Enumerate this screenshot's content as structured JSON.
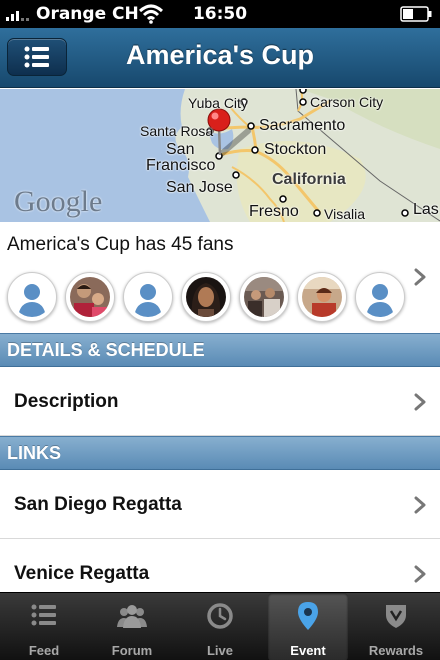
{
  "status_bar": {
    "carrier": "Orange CH",
    "time": "16:50"
  },
  "nav": {
    "title": "America's Cup",
    "menu_icon": "list-icon"
  },
  "map": {
    "attribution": "Google",
    "places": {
      "yuba_city": "Yuba City",
      "carson_city": "Carson City",
      "santa_rosa": "Santa Rosa",
      "sacramento": "Sacramento",
      "san_francisco_1": "San",
      "san_francisco_2": "Francisco",
      "stockton": "Stockton",
      "california": "California",
      "san_jose": "San Jose",
      "fresno": "Fresno",
      "visalia": "Visalia",
      "las": "Las"
    }
  },
  "fans": {
    "title": "America's Cup has 45 fans",
    "avatars": [
      "placeholder",
      "photo",
      "placeholder",
      "photo",
      "photo",
      "photo",
      "placeholder"
    ]
  },
  "sections": {
    "details_header": "DETAILS & SCHEDULE",
    "description": "Description",
    "links_header": "LINKS",
    "san_diego": "San Diego Regatta",
    "venice": "Venice Regatta"
  },
  "tabs": [
    {
      "label": "Feed",
      "icon": "list-icon"
    },
    {
      "label": "Forum",
      "icon": "people-icon"
    },
    {
      "label": "Live",
      "icon": "clock-icon"
    },
    {
      "label": "Event",
      "icon": "location-pin-icon",
      "active": true
    },
    {
      "label": "Rewards",
      "icon": "shield-icon"
    }
  ],
  "colors": {
    "nav_bar": "#17486d",
    "section_header": "#5a8bb5",
    "event_pin": "#4aa3e8"
  }
}
